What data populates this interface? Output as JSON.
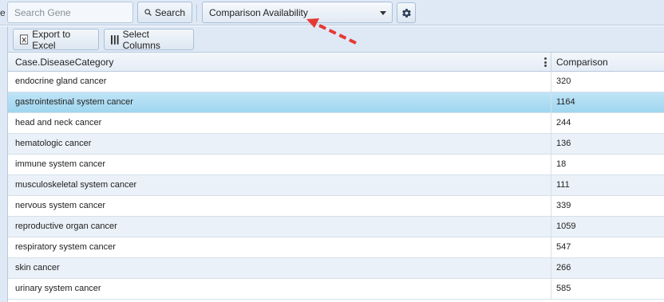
{
  "toolbar": {
    "left_edge_label": "e",
    "search_placeholder": "Search Gene",
    "search_label": "Search",
    "dropdown_value": "Comparison Availability"
  },
  "grid_toolbar": {
    "export_label": "Export to Excel",
    "columns_label": "Select Columns"
  },
  "grid": {
    "columns": [
      "Case.DiseaseCategory",
      "Comparison"
    ],
    "selected_row_index": 1,
    "rows": [
      {
        "category": "endocrine gland cancer",
        "comparison": "320"
      },
      {
        "category": "gastrointestinal system cancer",
        "comparison": "1164"
      },
      {
        "category": "head and neck cancer",
        "comparison": "244"
      },
      {
        "category": "hematologic cancer",
        "comparison": "136"
      },
      {
        "category": "immune system cancer",
        "comparison": "18"
      },
      {
        "category": "musculoskeletal system cancer",
        "comparison": "111"
      },
      {
        "category": "nervous system cancer",
        "comparison": "339"
      },
      {
        "category": "reproductive organ cancer",
        "comparison": "1059"
      },
      {
        "category": "respiratory system cancer",
        "comparison": "547"
      },
      {
        "category": "skin cancer",
        "comparison": "266"
      },
      {
        "category": "urinary system cancer",
        "comparison": "585"
      }
    ]
  },
  "icons": {
    "search": "search-icon",
    "dropdown": "chevron-down-icon",
    "settings": "gear-icon",
    "excel": "excel-icon",
    "columns": "columns-icon",
    "column_menu": "column-menu-icon"
  },
  "colors": {
    "toolbar_bg": "#dfe9f5",
    "selected_row": "#aee0f4",
    "alt_row": "#eaf1f8",
    "annotation_arrow": "#e53935"
  }
}
